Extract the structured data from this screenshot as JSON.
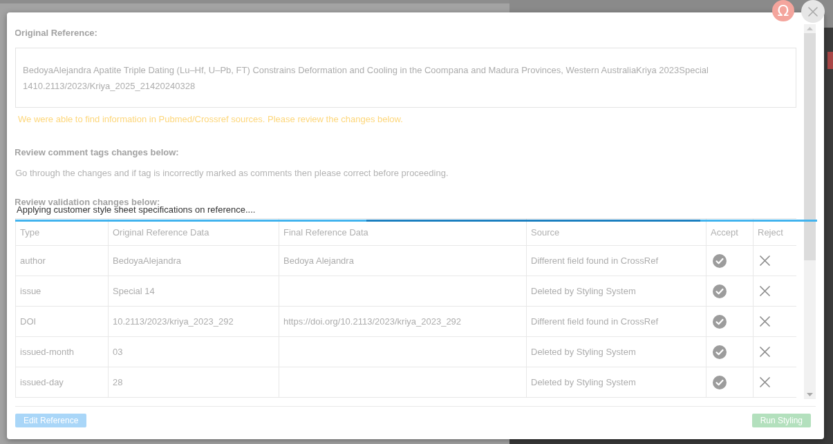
{
  "background": {
    "symbol_button": {
      "label": "Ω"
    }
  },
  "dialog": {
    "original_reference": {
      "heading": "Original Reference:",
      "text": "BedoyaAlejandra Apatite Triple Dating (Lu–Hf, U–Pb, FT) Constrains Deformation and Cooling in the Coompana and Madura Provinces, Western AustraliaKriya 2023Special 1410.2113/2023/Kriya_2025_21420240328"
    },
    "notice": "We were able to find information in Pubmed/Crossref sources. Please review the changes below.",
    "comment_tags": {
      "heading": "Review comment tags changes below:",
      "text": "Go through the changes and if tag is incorrectly marked as comments then please correct before proceeding."
    },
    "validation": {
      "heading": "Review validation changes below:",
      "loading_message": "Applying customer style sheet specifications on reference....",
      "table": {
        "columns": [
          "Type",
          "Original Reference Data",
          "Final Reference Data",
          "Source",
          "Accept",
          "Reject"
        ],
        "rows": [
          {
            "type": "author",
            "original": "BedoyaAlejandra",
            "final": "Bedoya Alejandra",
            "source": "Different field found in CrossRef"
          },
          {
            "type": "issue",
            "original": "Special 14",
            "source": "Deleted by Styling System"
          },
          {
            "type": "DOI",
            "original": "10.2113/2023/kriya_2023_292",
            "final": "https://doi.org/10.2113/2023/kriya_2023_292",
            "source": "Different field found in CrossRef"
          },
          {
            "type": "issued-month",
            "original": "03",
            "source": "Deleted by Styling System"
          },
          {
            "type": "issued-day",
            "original": "28",
            "source": "Deleted by Styling System"
          }
        ]
      }
    },
    "buttons": [
      {
        "label": "Edit Reference",
        "kind": "edit"
      },
      {
        "label": "Run Styling",
        "kind": "run"
      }
    ]
  }
}
